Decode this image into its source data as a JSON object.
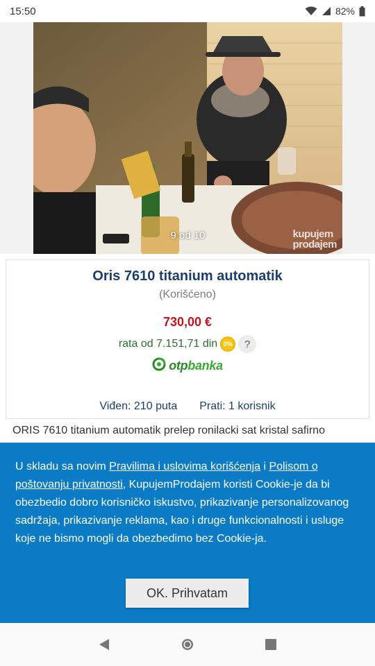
{
  "status_bar": {
    "time": "15:50",
    "battery": "82%",
    "icons": [
      "wifi-icon",
      "signal-icon",
      "battery-icon"
    ]
  },
  "gallery": {
    "counter": "9 od 10",
    "watermark_line1": "kupujem",
    "watermark_line2": "prodajem"
  },
  "listing": {
    "title": "Oris 7610 titanium automatik",
    "condition": "(Korišćeno)",
    "price": "730,00 €",
    "rate": "rata od 7.151,71 din",
    "zero_badge": "0%",
    "help": "?",
    "bank": {
      "otp": "otp",
      "banka": "banka"
    },
    "views": "Viđen: 210 puta",
    "followers": "Prati: 1 korisnik",
    "description": "ORIS 7610 titanium automatik prelep ronilacki sat kristal safirno"
  },
  "cookie": {
    "text_1": "U skladu sa novim ",
    "link_1": "Pravilima i uslovima korišćenja",
    "text_2": " i ",
    "link_2": "Polisom o poštovanju privatnosti",
    "text_3": ", KupujemProdajem koristi Cookie-je da bi obezbedio dobro korisničko iskustvo, prikazivanje personalizovanog sadržaja, prikazivanje reklama, kao i druge funkcionalnosti i usluge koje ne bismo mogli da obezbedimo bez Cookie-ja.",
    "accept_label": "OK. Prihvatam"
  },
  "colors": {
    "title": "#1c3e6e",
    "price": "#c4161c",
    "rate": "#2c6e2f",
    "bank": "#3aaa35",
    "cookie_bg": "#0a7bc4"
  },
  "nav": {
    "icons": [
      "back-icon",
      "home-icon",
      "recents-icon"
    ]
  }
}
